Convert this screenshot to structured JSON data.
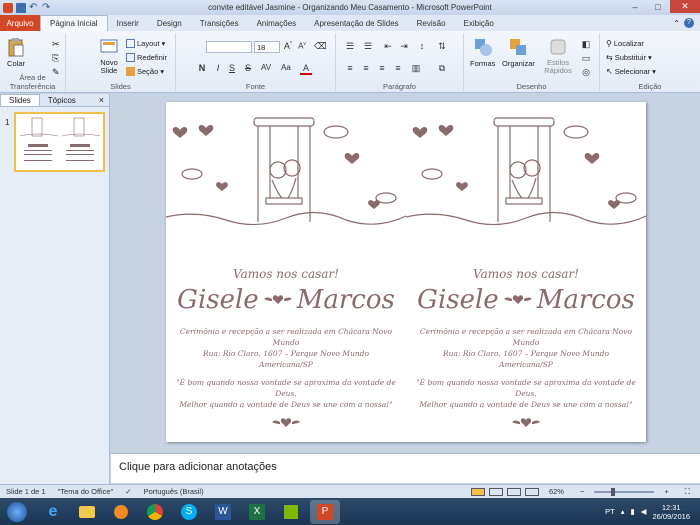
{
  "window": {
    "title": "convite editável Jasmine - Organizando Meu Casamento  -  Microsoft PowerPoint"
  },
  "tabs": [
    {
      "label": "Arquivo",
      "active": false,
      "file": true
    },
    {
      "label": "Página Inicial",
      "active": true
    },
    {
      "label": "Inserir",
      "active": false
    },
    {
      "label": "Design",
      "active": false
    },
    {
      "label": "Transições",
      "active": false
    },
    {
      "label": "Animações",
      "active": false
    },
    {
      "label": "Apresentação de Slides",
      "active": false
    },
    {
      "label": "Revisão",
      "active": false
    },
    {
      "label": "Exibição",
      "active": false
    }
  ],
  "ribbon": {
    "clipboard": {
      "paste": "Colar",
      "label": "Área de Transferência"
    },
    "slides": {
      "new_slide": "Novo Slide",
      "layout": "Layout",
      "reset": "Redefinir",
      "section": "Seção",
      "label": "Slides"
    },
    "font": {
      "font_name": "",
      "font_size": "18",
      "bold": "N",
      "italic": "I",
      "underline": "S",
      "strike": "S",
      "label": "Fonte"
    },
    "paragraph": {
      "label": "Parágrafo"
    },
    "drawing": {
      "shapes": "Formas",
      "arrange": "Organizar",
      "quick_styles": "Estilos Rápidos",
      "label": "Desenho"
    },
    "editing": {
      "find": "Localizar",
      "replace": "Substituir",
      "select": "Selecionar",
      "label": "Edição"
    }
  },
  "left_pane": {
    "tabs": [
      "Slides",
      "Tópicos"
    ],
    "close": "×",
    "slide_number": "1"
  },
  "slide": {
    "cards": [
      {
        "vamos": "Vamos nos casar!",
        "name1": "Gisele",
        "name2": "Marcos",
        "local_1": "Cerimônia e recepção a ser realizada em Chácara Novo Mundo",
        "local_2": "Rua: Rio Claro, 1607 – Parque Novo Mundo",
        "local_3": "Americana/SP",
        "quote_1": "\"É bom quando nossa vontade se aproxima da vontade de Deus.",
        "quote_2": "Melhor quando a vontade de Deus se une com a nossa!\""
      },
      {
        "vamos": "Vamos nos casar!",
        "name1": "Gisele",
        "name2": "Marcos",
        "local_1": "Cerimônia e recepção a ser realizada em Chácara Novo Mundo",
        "local_2": "Rua: Rio Claro, 1607 – Parque Novo Mundo",
        "local_3": "Americana/SP",
        "quote_1": "\"É bom quando nossa vontade se aproxima da vontade de Deus.",
        "quote_2": "Melhor quando a vontade de Deus se une com a nossa!\""
      }
    ]
  },
  "notes": {
    "placeholder": "Clique para adicionar anotações"
  },
  "status": {
    "slide_of": "Slide 1 de 1",
    "theme": "\"Tema do Office\"",
    "language": "Português (Brasil)",
    "zoom": "62%",
    "zoom_level": 0.62
  },
  "taskbar": {
    "lang": "PT",
    "time": "12:31",
    "date": "26/09/2016"
  },
  "colors": {
    "file_tab": "#d24726",
    "illustration": "#8a6a6a",
    "thumb_border": "#f0c04a"
  }
}
